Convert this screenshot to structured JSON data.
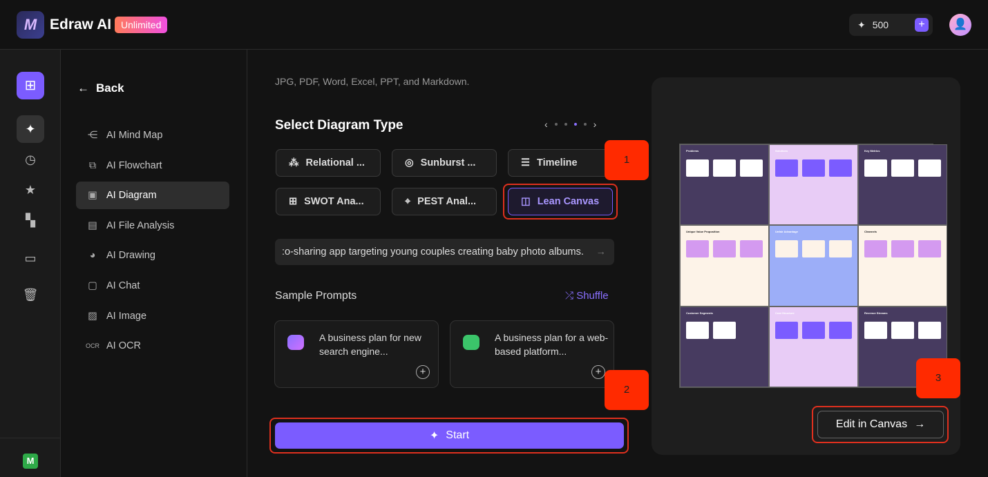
{
  "header": {
    "app_name": "Edraw AI",
    "plan_badge": "Unlimited",
    "credits": "500",
    "add_credits": "+"
  },
  "rail": {
    "user_initial": "M"
  },
  "menu": {
    "back": "Back",
    "items": [
      {
        "label": "AI Mind Map",
        "icon": "mind-map-icon"
      },
      {
        "label": "AI Flowchart",
        "icon": "flowchart-icon"
      },
      {
        "label": "AI Diagram",
        "icon": "diagram-icon",
        "active": true
      },
      {
        "label": "AI File Analysis",
        "icon": "file-analysis-icon"
      },
      {
        "label": "AI Drawing",
        "icon": "palette-icon"
      },
      {
        "label": "AI Chat",
        "icon": "chat-icon"
      },
      {
        "label": "AI Image",
        "icon": "image-icon"
      },
      {
        "label": "AI OCR",
        "icon": "ocr-icon"
      }
    ]
  },
  "main": {
    "formats_text": "JPG, PDF, Word, Excel, PPT, and Markdown.",
    "select_title": "Select Diagram Type",
    "diagram_types": [
      {
        "label": "Relational ...",
        "icon": "relational-icon"
      },
      {
        "label": "Sunburst ...",
        "icon": "sunburst-icon"
      },
      {
        "label": "Timeline",
        "icon": "timeline-icon"
      },
      {
        "label": "SWOT Ana...",
        "icon": "swot-icon"
      },
      {
        "label": "PEST Anal...",
        "icon": "pest-icon"
      },
      {
        "label": "Lean Canvas",
        "icon": "lean-canvas-icon",
        "selected": true
      }
    ],
    "prompt_value": ":o-sharing app targeting young couples creating baby photo albums.",
    "sample_prompts_title": "Sample Prompts",
    "shuffle": "Shuffle",
    "samples": [
      {
        "text": "A business plan for new search engine..."
      },
      {
        "text": "A business plan for a web-based platform..."
      }
    ],
    "start": "Start"
  },
  "annotations": [
    "1",
    "2",
    "3"
  ],
  "preview": {
    "canvas_sections": [
      "Problems",
      "Solutions",
      "Key Metrics",
      "Unique Value Proposition",
      "Unfair Advantage",
      "Channels",
      "Customer Segments",
      "Cost Structure",
      "Revenue Streams"
    ],
    "edit_button": "Edit in Canvas"
  },
  "colors": {
    "accent": "#7b5cff",
    "highlight": "#e0301e",
    "dark_cell": "#473b60",
    "lilac_cell": "#e8ccf6",
    "cream_cell": "#fdf3e8",
    "blue_cell": "#9caef8"
  }
}
